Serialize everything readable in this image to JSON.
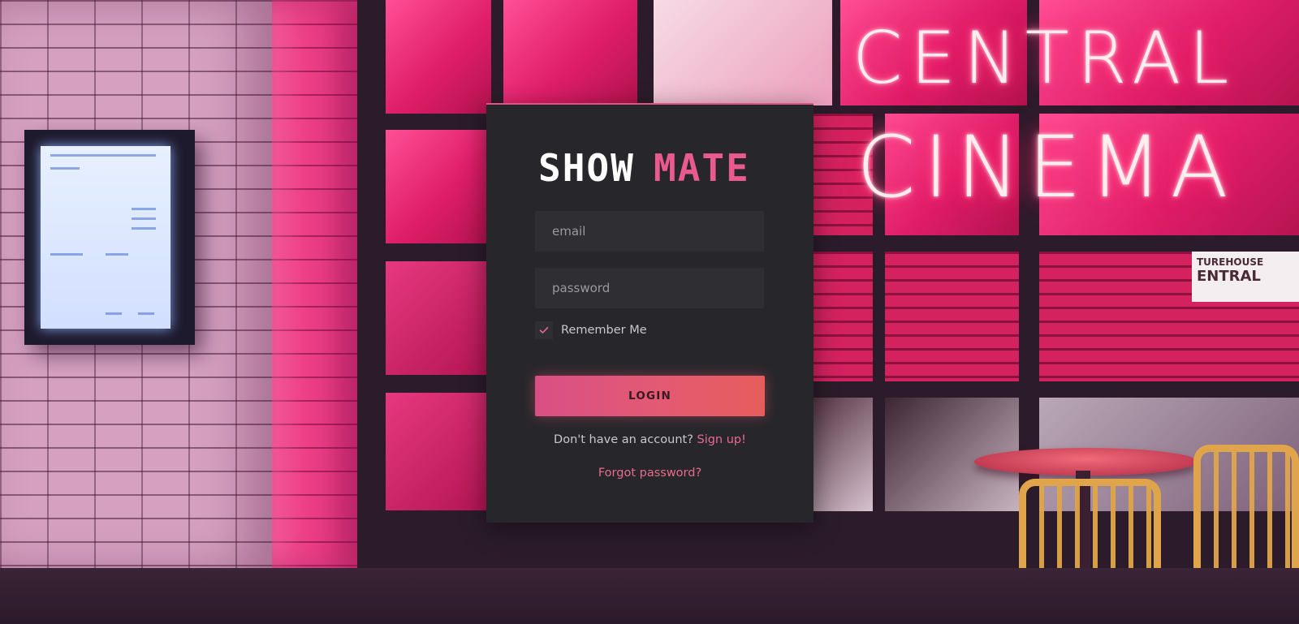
{
  "brand": {
    "logo_part1": "SHOW",
    "logo_part2": "MATE",
    "logo_color_part1": "#ffffff",
    "logo_color_part2": "#ea5a8f"
  },
  "background": {
    "neon_line1": "CENTRAL",
    "neon_line2": "CINEMA",
    "sign_top": "TUREHOUSE",
    "sign_bottom": "ENTRAL"
  },
  "login_form": {
    "email_placeholder": "email",
    "password_placeholder": "password",
    "remember_label": "Remember Me",
    "remember_checked": true,
    "login_button_label": "LOGIN",
    "signup_prompt": "Don't have an account?",
    "signup_link": "Sign up!",
    "forgot_link": "Forgot password?"
  },
  "colors": {
    "accent": "#e86a8f",
    "card_bg": "#27272b",
    "input_bg": "#2f2f33",
    "button_gradient_start": "#d94f85",
    "button_gradient_end": "#e65d5c"
  }
}
